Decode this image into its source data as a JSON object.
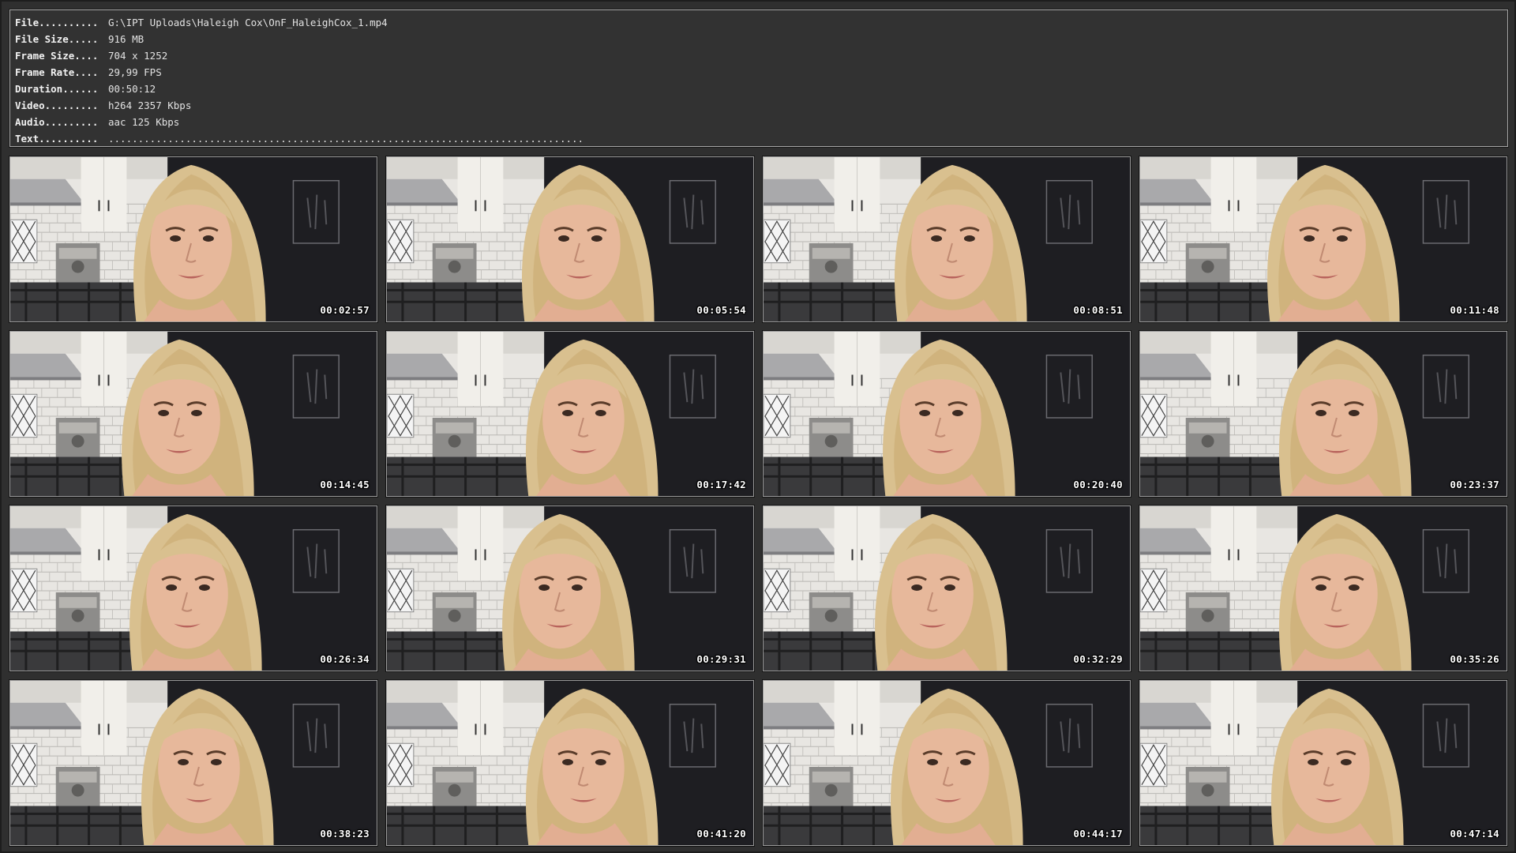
{
  "info": [
    {
      "label": "File..........",
      "value": "G:\\IPT Uploads\\Haleigh Cox\\OnF_HaleighCox_1.mp4"
    },
    {
      "label": "File Size.....",
      "value": "916 MB"
    },
    {
      "label": "Frame Size....",
      "value": "704 x 1252"
    },
    {
      "label": "Frame Rate....",
      "value": "29,99 FPS"
    },
    {
      "label": "Duration......",
      "value": "00:50:12"
    },
    {
      "label": "Video.........",
      "value": "h264 2357 Kbps"
    },
    {
      "label": "Audio.........",
      "value": "aac 125 Kbps"
    },
    {
      "label": "Text..........",
      "value": "................................................................................"
    }
  ],
  "thumbnails": [
    {
      "time": "00:02:57"
    },
    {
      "time": "00:05:54"
    },
    {
      "time": "00:08:51"
    },
    {
      "time": "00:11:48"
    },
    {
      "time": "00:14:45"
    },
    {
      "time": "00:17:42"
    },
    {
      "time": "00:20:40"
    },
    {
      "time": "00:23:37"
    },
    {
      "time": "00:26:34"
    },
    {
      "time": "00:29:31"
    },
    {
      "time": "00:32:29"
    },
    {
      "time": "00:35:26"
    },
    {
      "time": "00:38:23"
    },
    {
      "time": "00:41:20"
    },
    {
      "time": "00:44:17"
    },
    {
      "time": "00:47:14"
    }
  ],
  "colors": {
    "background": "#2f2f2f",
    "panel": "#323232",
    "border": "#a6a6a6",
    "text": "#e6e6e6",
    "tile": "#e8e6e2",
    "cabinet": "#f1efea",
    "wall_dark": "#1e1e22",
    "hair": "#d9c08f",
    "skin": "#e7b89b"
  }
}
